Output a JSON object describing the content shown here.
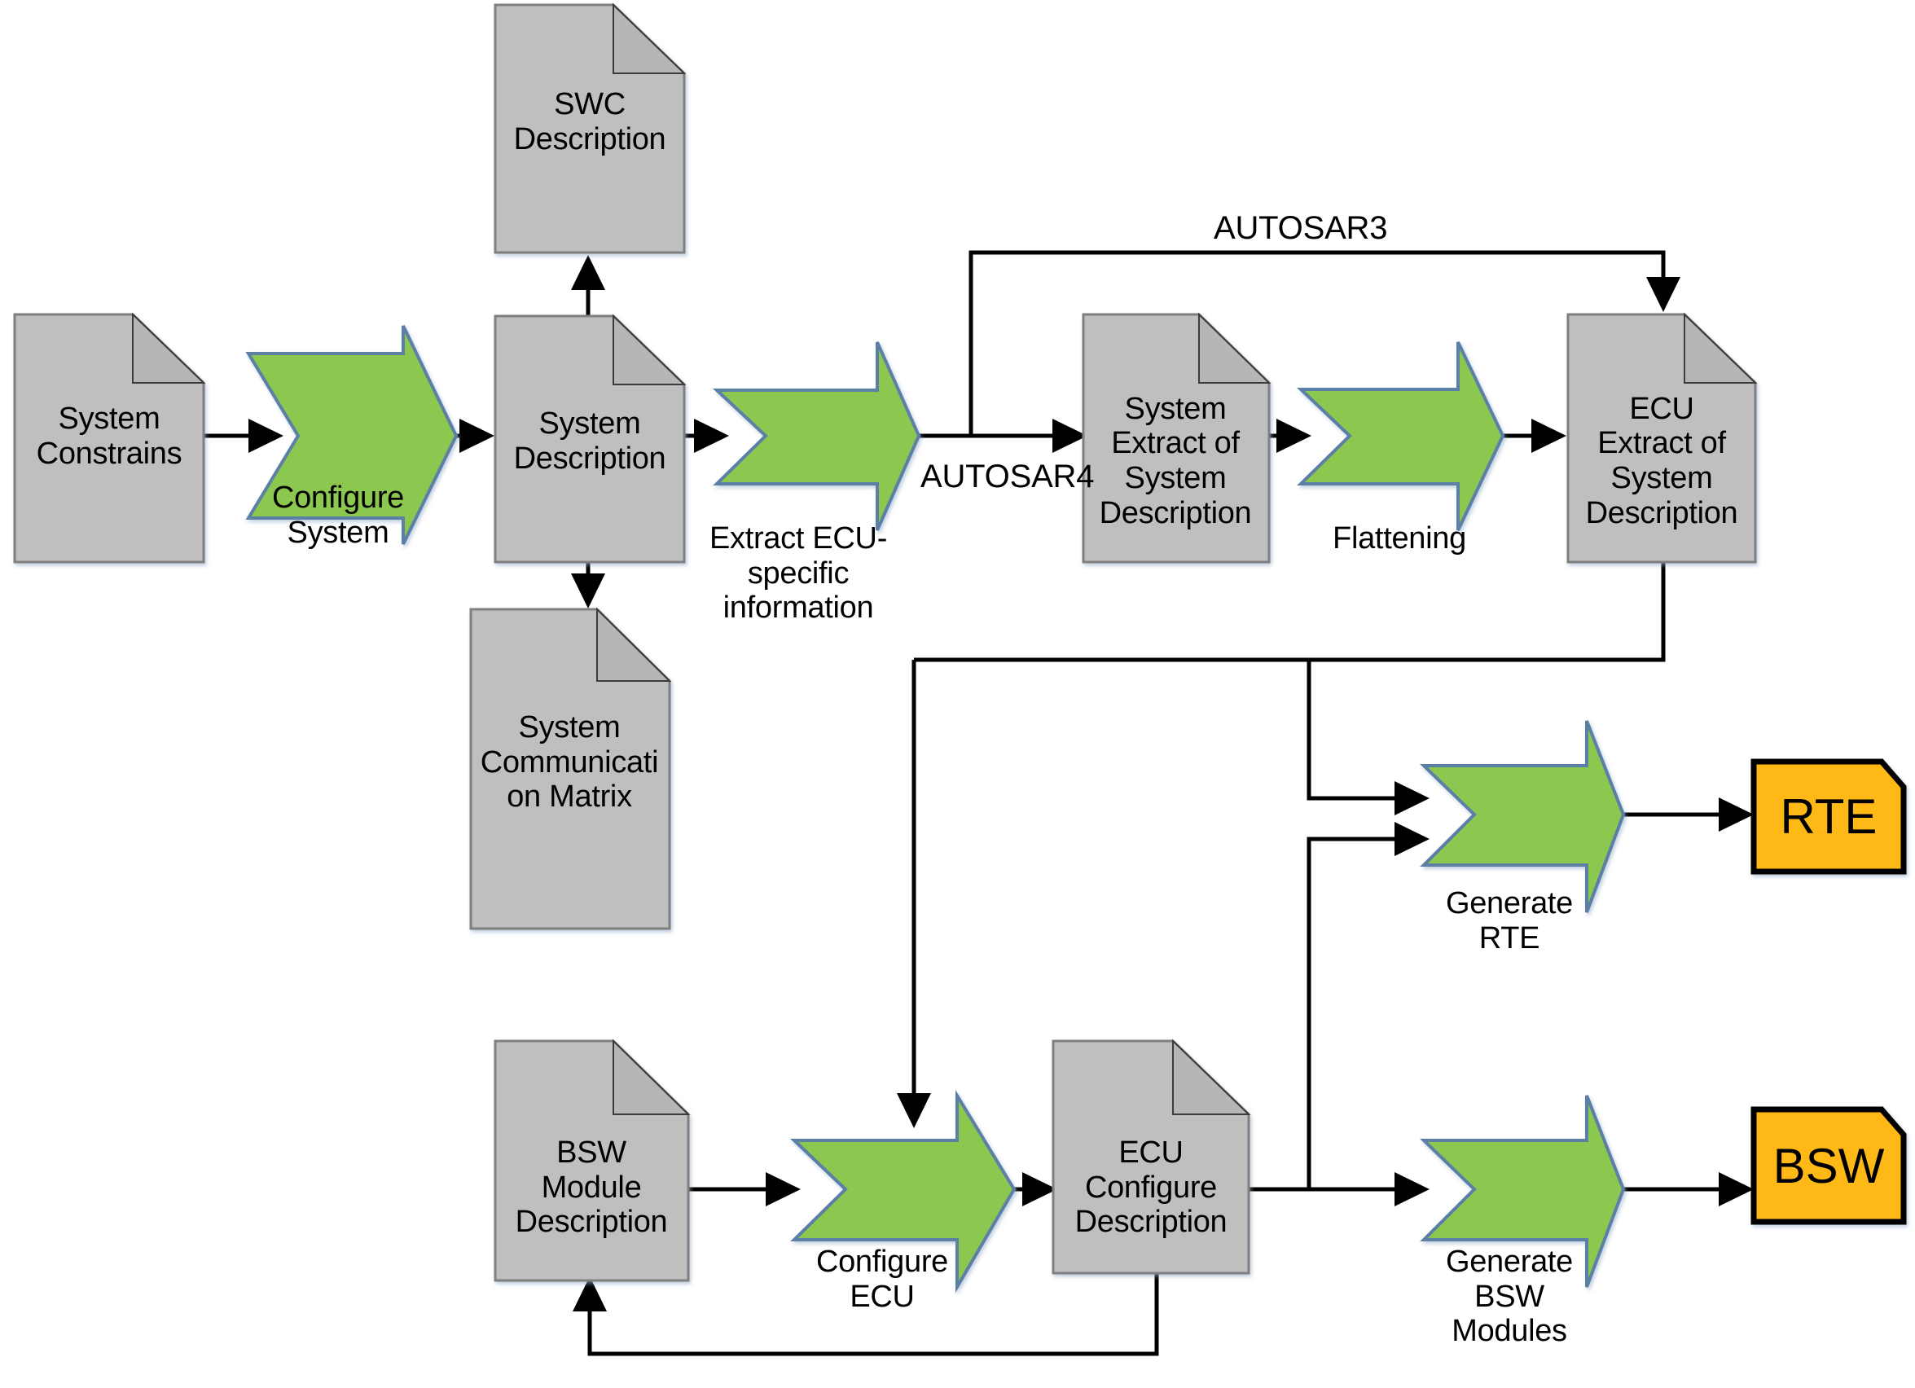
{
  "diagram": {
    "title": "AUTOSAR methodology flow",
    "colors": {
      "document_fill": "#BFBFBF",
      "document_stroke": "#7F7F7F",
      "document_fold": "#B3B3B3",
      "arrow_fill": "#8CC850",
      "arrow_stroke": "#5B7FA6",
      "output_fill": "#FFB913",
      "output_stroke": "#000000",
      "connector": "#000000",
      "background": "#FFFFFF"
    },
    "documents": [
      {
        "id": "system-constrains",
        "lines": [
          "System",
          "Constrains"
        ]
      },
      {
        "id": "swc-description",
        "lines": [
          "SWC",
          "Description"
        ]
      },
      {
        "id": "system-description",
        "lines": [
          "System",
          "Description"
        ]
      },
      {
        "id": "system-communication-matrix",
        "lines": [
          "System",
          "Communicati",
          "on Matrix"
        ]
      },
      {
        "id": "system-extract-of-system-description",
        "lines": [
          "System",
          "Extract of",
          "System",
          "Description"
        ]
      },
      {
        "id": "ecu-extract-of-system-description",
        "lines": [
          "ECU",
          "Extract of",
          "System",
          "Description"
        ]
      },
      {
        "id": "bsw-module-description",
        "lines": [
          "BSW",
          "Module",
          "Description"
        ]
      },
      {
        "id": "ecu-configure-description",
        "lines": [
          "ECU",
          "Configure",
          "Description"
        ]
      }
    ],
    "processes": [
      {
        "id": "configure-system",
        "lines": [
          "Configure",
          "System"
        ]
      },
      {
        "id": "extract-ecu-specific-information",
        "lines": [
          "Extract ECU-",
          "specific",
          "information"
        ]
      },
      {
        "id": "flattening",
        "lines": [
          "Flattening"
        ]
      },
      {
        "id": "generate-rte",
        "lines": [
          "Generate",
          "RTE"
        ]
      },
      {
        "id": "configure-ecu",
        "lines": [
          "Configure",
          "ECU"
        ]
      },
      {
        "id": "generate-bsw-modules",
        "lines": [
          "Generate",
          "BSW",
          "Modules"
        ]
      }
    ],
    "outputs": [
      {
        "id": "rte",
        "label": "RTE"
      },
      {
        "id": "bsw",
        "label": "BSW"
      }
    ],
    "edge_labels": [
      {
        "id": "autosar3",
        "text": "AUTOSAR3"
      },
      {
        "id": "autosar4",
        "text": "AUTOSAR4"
      }
    ]
  }
}
